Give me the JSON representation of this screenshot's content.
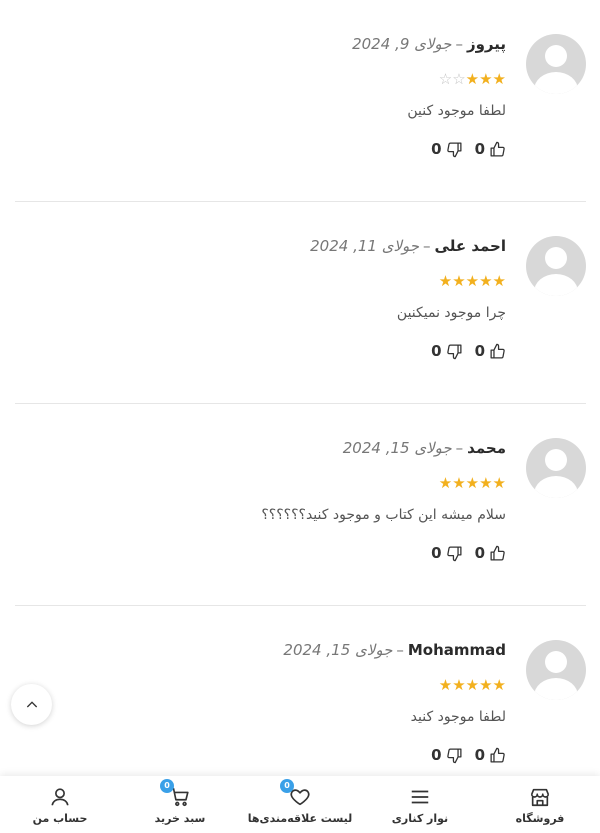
{
  "reviews": [
    {
      "author": "پیروز",
      "date": "جولای 9, 2024",
      "rating": 3,
      "text": "لطفا موجود کنین",
      "likes": "0",
      "dislikes": "0"
    },
    {
      "author": "احمد علی",
      "date": "جولای 11, 2024",
      "rating": 5,
      "text": "چرا موجود نمیکنین",
      "likes": "0",
      "dislikes": "0"
    },
    {
      "author": "محمد",
      "date": "جولای 15, 2024",
      "rating": 5,
      "text": "سلام میشه این کتاب و موجود کنید؟؟؟؟؟؟",
      "likes": "0",
      "dislikes": "0"
    },
    {
      "author": "Mohammad",
      "date": "جولای 15, 2024",
      "rating": 5,
      "text": "لطفا موجود کنید",
      "likes": "0",
      "dislikes": "0"
    }
  ],
  "separator": "–",
  "bottom_nav": {
    "shop": "فروشگاه",
    "sidebar": "نوار کناری",
    "wishlist": "لیست علاقه‌مندی‌ها",
    "wishlist_count": "0",
    "cart": "سبد خرید",
    "cart_count": "0",
    "account": "حساب من"
  },
  "colors": {
    "star": "#f2b01e",
    "badge": "#3aa0e8"
  },
  "icons": {
    "scroll_top": "chevron-up-icon",
    "shop": "store-icon",
    "sidebar": "menu-icon",
    "wishlist": "heart-icon",
    "cart": "cart-icon",
    "account": "user-icon"
  }
}
